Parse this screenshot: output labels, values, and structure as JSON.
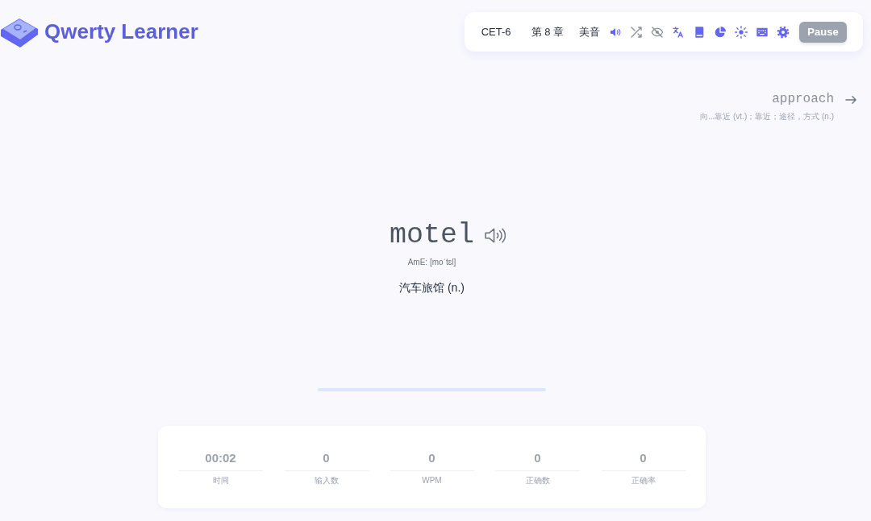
{
  "header": {
    "logo_text": "Qwerty Learner"
  },
  "toolbar": {
    "dictionary": "CET-6",
    "chapter": "第 8 章",
    "pronunciation": "美音",
    "toggles": [
      {
        "on": true
      },
      {
        "on": false
      },
      {
        "on": false
      },
      {
        "on": true
      }
    ],
    "pause_button": "Pause"
  },
  "next_word": {
    "word": "approach",
    "translation": "向...靠近 (vt.)；靠近；途径，方式 (n.)"
  },
  "current_word": {
    "word": "motel",
    "phonetic": "AmE: [moˈtɛl]",
    "translation": "汽车旅馆 (n.)"
  },
  "progress": {
    "level": 0
  },
  "stats": [
    {
      "value": "00:02",
      "label": "时间"
    },
    {
      "value": "0",
      "label": "输入数"
    },
    {
      "value": "0",
      "label": "WPM"
    },
    {
      "value": "0",
      "label": "正确数"
    },
    {
      "value": "0",
      "label": "正确率"
    }
  ]
}
